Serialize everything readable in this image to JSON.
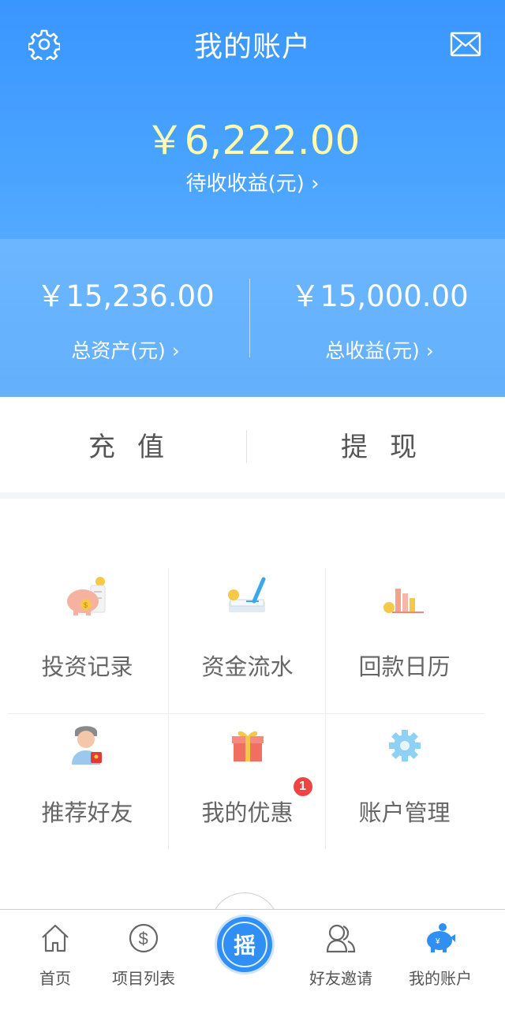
{
  "header": {
    "title": "我的账户",
    "settings_icon": "gear-icon",
    "mail_icon": "mail-icon",
    "pending": {
      "amount": "￥6,222.00",
      "label": "待收收益(元) ›"
    },
    "total_assets": {
      "amount": "￥15,236.00",
      "label": "总资产(元) ›"
    },
    "total_income": {
      "amount": "￥15,000.00",
      "label": "总收益(元) ›"
    }
  },
  "actions": {
    "recharge": "充值",
    "withdraw": "提现"
  },
  "grid": {
    "items": [
      {
        "label": "投资记录",
        "icon": "piggy-bank-icon"
      },
      {
        "label": "资金流水",
        "icon": "book-pen-icon"
      },
      {
        "label": "回款日历",
        "icon": "bar-chart-icon"
      },
      {
        "label": "推荐好友",
        "icon": "user-redpacket-icon"
      },
      {
        "label": "我的优惠",
        "icon": "gift-icon",
        "badge": "1"
      },
      {
        "label": "账户管理",
        "icon": "gear-icon"
      }
    ]
  },
  "tabbar": {
    "items": [
      {
        "label": "首页",
        "icon": "home-icon"
      },
      {
        "label": "项目列表",
        "icon": "dollar-icon"
      },
      {
        "label": "好友邀请",
        "icon": "friends-icon"
      },
      {
        "label": "我的账户",
        "icon": "piggy-bank-icon",
        "active": true
      }
    ],
    "center": {
      "label": "摇"
    }
  },
  "colors": {
    "header_top": "#3a96ff",
    "header_bottom": "#6fb8ff",
    "amount_highlight": "#fffbb0",
    "accent": "#2f8ff5",
    "badge": "#f04343"
  }
}
